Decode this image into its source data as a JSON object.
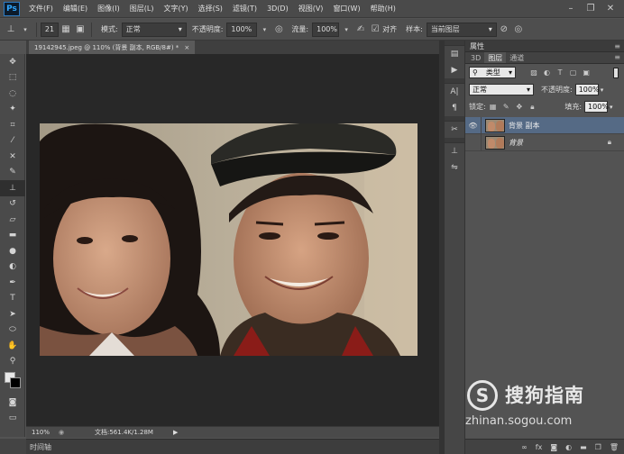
{
  "app": {
    "logo": "Ps"
  },
  "menu": [
    "文件(F)",
    "编辑(E)",
    "图像(I)",
    "图层(L)",
    "文字(Y)",
    "选择(S)",
    "滤镜(T)",
    "3D(D)",
    "视图(V)",
    "窗口(W)",
    "帮助(H)"
  ],
  "window_controls": {
    "minimize": "–",
    "restore": "❐",
    "close": "✕"
  },
  "options": {
    "brush_size": "21",
    "mode_label": "模式:",
    "mode_value": "正常",
    "opacity_label": "不透明度:",
    "opacity_value": "100%",
    "flow_label": "流量:",
    "flow_value": "100%",
    "align_label": "对齐",
    "sample_label": "样本:",
    "sample_value": "当前图层"
  },
  "document": {
    "tab_title": "19142945.jpeg @ 110% (背景 副本, RGB/8#) *",
    "close": "×"
  },
  "status": {
    "zoom": "110%",
    "doc_info": "文档:561.4K/1.28M"
  },
  "timeline": {
    "label": "时间轴"
  },
  "panels": {
    "properties_title": "属性",
    "tabs": [
      "3D",
      "图层",
      "通道"
    ],
    "filter_kind": "类型",
    "blend_mode": "正常",
    "opacity_label": "不透明度:",
    "opacity_value": "100%",
    "lock_label": "锁定:",
    "fill_label": "填充:",
    "fill_value": "100%",
    "layers": [
      {
        "name": "背景 副本",
        "visible": true,
        "selected": true
      },
      {
        "name": "背景",
        "visible": false,
        "selected": false
      }
    ],
    "bottom_icons": [
      "link",
      "fx",
      "mask",
      "adjust",
      "folder",
      "new",
      "trash"
    ]
  },
  "watermark": {
    "logo": "S",
    "text": "搜狗指南",
    "url": "zhinan.sogou.com"
  },
  "tools": [
    "move-icon",
    "marquee-icon",
    "lasso-icon",
    "magic-wand-icon",
    "crop-icon",
    "eyedropper-icon",
    "healing-icon",
    "brush-icon",
    "clone-stamp-icon",
    "history-brush-icon",
    "eraser-icon",
    "gradient-icon",
    "blur-icon",
    "dodge-icon",
    "pen-icon",
    "type-icon",
    "path-select-icon",
    "shape-icon",
    "hand-icon",
    "zoom-icon"
  ],
  "colors": {
    "selected_layer": "#556a85",
    "canvas_bg": "#282828",
    "panel_bg": "#535353"
  }
}
